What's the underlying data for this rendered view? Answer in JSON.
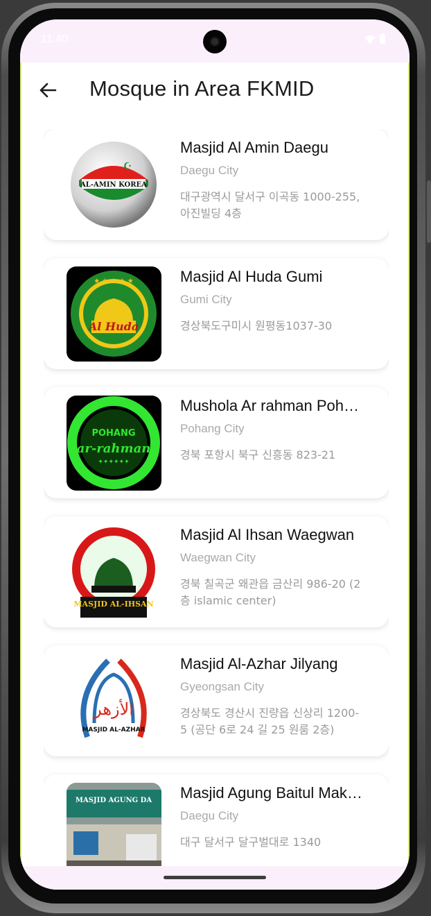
{
  "app_bar": {
    "title": "Mosque in Area FKMID",
    "back_icon": "arrow-left-icon"
  },
  "status_bar": {
    "time": "11:40",
    "indicators": "G ⊘ G"
  },
  "colors": {
    "accent_border": "#d8f07a",
    "status_bg": "#fbeffb",
    "name_text": "#111111",
    "secondary_text": "#a9a9a9"
  },
  "mosques": [
    {
      "name": "Masjid Al Amin Daegu",
      "city": "Daegu City",
      "address": "대구광역시 달서구 이곡동 1000-255, 아진빌딩 4층",
      "logo_text": "AL-AMIN KOREA"
    },
    {
      "name": "Masjid Al Huda Gumi",
      "city": "Gumi City",
      "address": "경상북도구미시 원평동1037-30",
      "logo_text": "Al Huda"
    },
    {
      "name": "Mushola Ar rahman Pohang",
      "city": "Pohang City",
      "address": "경북 포항시 북구 신흥동 823-21",
      "logo_text": "POHANG"
    },
    {
      "name": "Masjid Al Ihsan Waegwan",
      "city": "Waegwan City",
      "address": "경북 칠곡군 왜관읍 금산리 986-20 (2층 islamic center)",
      "logo_text": "MASJID AL-IHSAN"
    },
    {
      "name": "Masjid Al-Azhar Jilyang",
      "city": "Gyeongsan City",
      "address": "경상북도 경산시 진량읍 신상리 1200-5 (공단 6로 24 길 25 원룸 2층)",
      "logo_text": "MASJID AL-AZHAR"
    },
    {
      "name": "Masjid Agung Baitul Makmur",
      "city": "Daegu City",
      "address": "대구 달서구 달구벌대로 1340",
      "logo_text": "MASJID AGUNG DA"
    }
  ]
}
